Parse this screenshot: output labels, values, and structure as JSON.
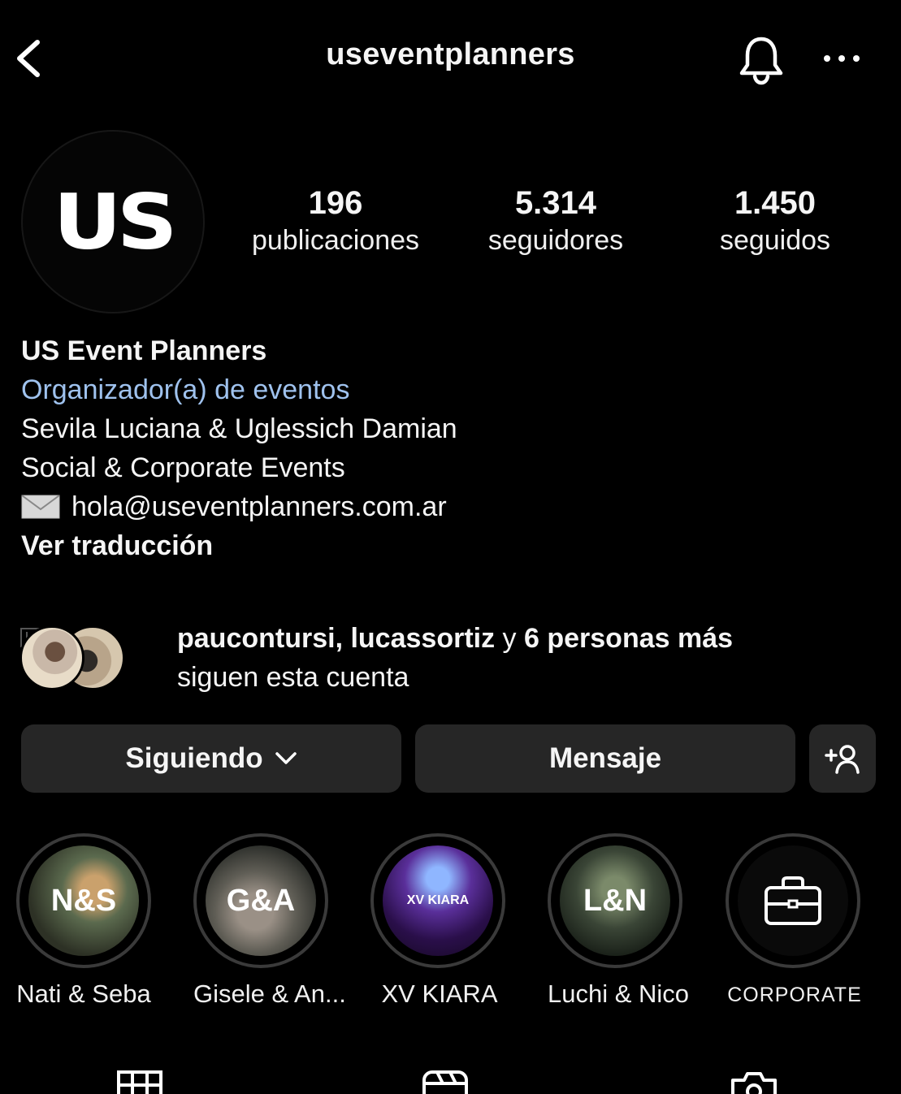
{
  "header": {
    "username": "useventplanners"
  },
  "profile": {
    "avatar_text": "US",
    "stats": [
      {
        "value": "196",
        "label": "publicaciones"
      },
      {
        "value": "5.314",
        "label": "seguidores"
      },
      {
        "value": "1.450",
        "label": "seguidos"
      }
    ],
    "name": "US Event Planners",
    "category": "Organizador(a) de eventos",
    "bio_lines": [
      "Sevila Luciana & Uglessich Damian",
      "Social & Corporate Events"
    ],
    "email": "hola@useventplanners.com.ar",
    "translate_label": "Ver traducción"
  },
  "followed_by": {
    "names": "paucontursi, lucassortiz",
    "connector": " y ",
    "others": "6 personas más",
    "suffix": "siguen esta cuenta"
  },
  "actions": {
    "following_label": "Siguiendo",
    "message_label": "Mensaje"
  },
  "highlights": [
    {
      "cover_text": "N&S",
      "label": "Nati & Seba"
    },
    {
      "cover_text": "G&A",
      "label": "Gisele & An..."
    },
    {
      "cover_text": "XV KIARA",
      "label": "XV KIARA"
    },
    {
      "cover_text": "L&N",
      "label": "Luchi & Nico"
    },
    {
      "icon": "briefcase-icon",
      "label": "CORPORATE"
    }
  ],
  "icons": {
    "back": "chevron-left-icon",
    "notifications": "bell-icon",
    "more": "more-horizontal-icon",
    "add_user": "add-user-icon",
    "grid": "grid-icon",
    "reels": "reels-icon",
    "tagged": "tagged-icon",
    "mail": "envelope-icon"
  },
  "colors": {
    "background": "#000000",
    "button_bg": "#262626",
    "category_link": "#9fc2ee"
  }
}
